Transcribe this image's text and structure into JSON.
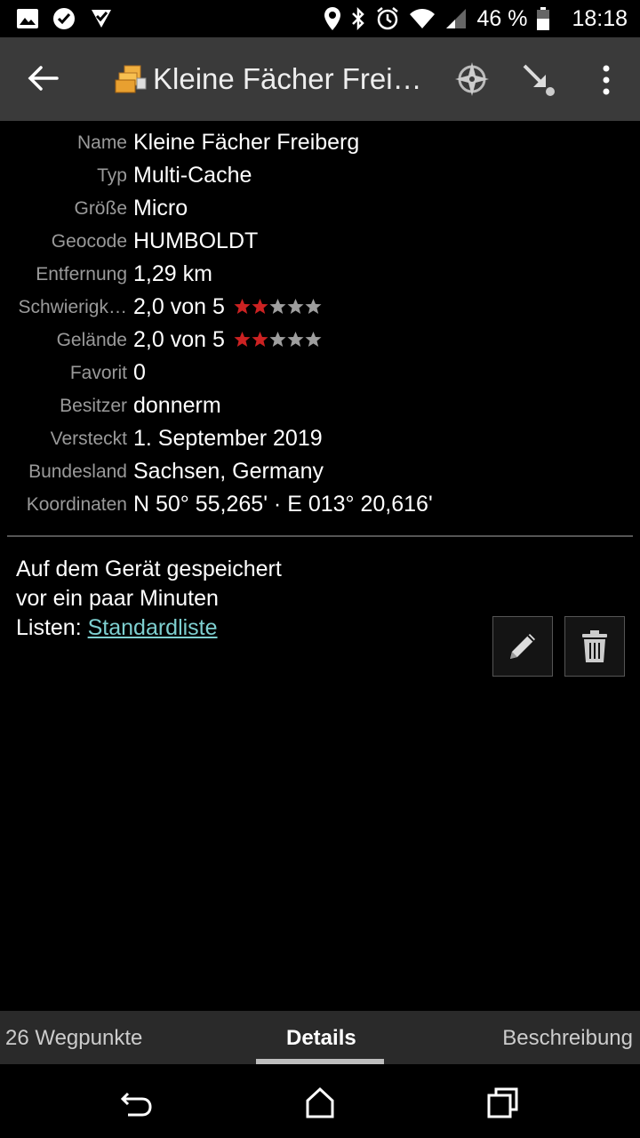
{
  "status_bar": {
    "battery_percent": "46 %",
    "time": "18:18",
    "left_icons": [
      "image-icon",
      "check-circle-icon",
      "download-check-icon"
    ],
    "right_icons": [
      "location-icon",
      "bluetooth-icon",
      "alarm-icon",
      "wifi-icon",
      "signal-icon",
      "battery-icon"
    ]
  },
  "action_bar": {
    "title": "Kleine Fächer Frei…",
    "icons": [
      "back-arrow-icon",
      "multi-cache-icon",
      "compass-icon",
      "navigate-icon",
      "overflow-menu-icon"
    ]
  },
  "details": [
    {
      "label": "Name",
      "value": "Kleine Fächer Freiberg"
    },
    {
      "label": "Typ",
      "value": "Multi-Cache"
    },
    {
      "label": "Größe",
      "value": "Micro"
    },
    {
      "label": "Geocode",
      "value": "HUMBOLDT"
    },
    {
      "label": "Entfernung",
      "value": "1,29 km"
    },
    {
      "label": "Schwierigk…",
      "value": "2,0 von 5",
      "stars_filled": 2,
      "stars_total": 5
    },
    {
      "label": "Gelände",
      "value": "2,0 von 5",
      "stars_filled": 2,
      "stars_total": 5
    },
    {
      "label": "Favorit",
      "value": "0"
    },
    {
      "label": "Besitzer",
      "value": "donnerm"
    },
    {
      "label": "Versteckt",
      "value": "1. September 2019"
    },
    {
      "label": "Bundesland",
      "value": "Sachsen, Germany"
    },
    {
      "label": "Koordinaten",
      "value": "N 50° 55,265' · E 013° 20,616'"
    }
  ],
  "storage": {
    "line1": "Auf dem Gerät gespeichert",
    "line2": "vor ein paar Minuten",
    "lists_label": "Listen: ",
    "lists_link": "Standardliste"
  },
  "tabs": {
    "waypoints": "26 Wegpunkte",
    "details": "Details",
    "description": "Beschreibung",
    "active": "details"
  },
  "colors": {
    "star_filled": "#cc2222",
    "star_empty": "#9e9e9e",
    "link": "#7ecfd0",
    "action_bar": "#3a3a3a"
  }
}
